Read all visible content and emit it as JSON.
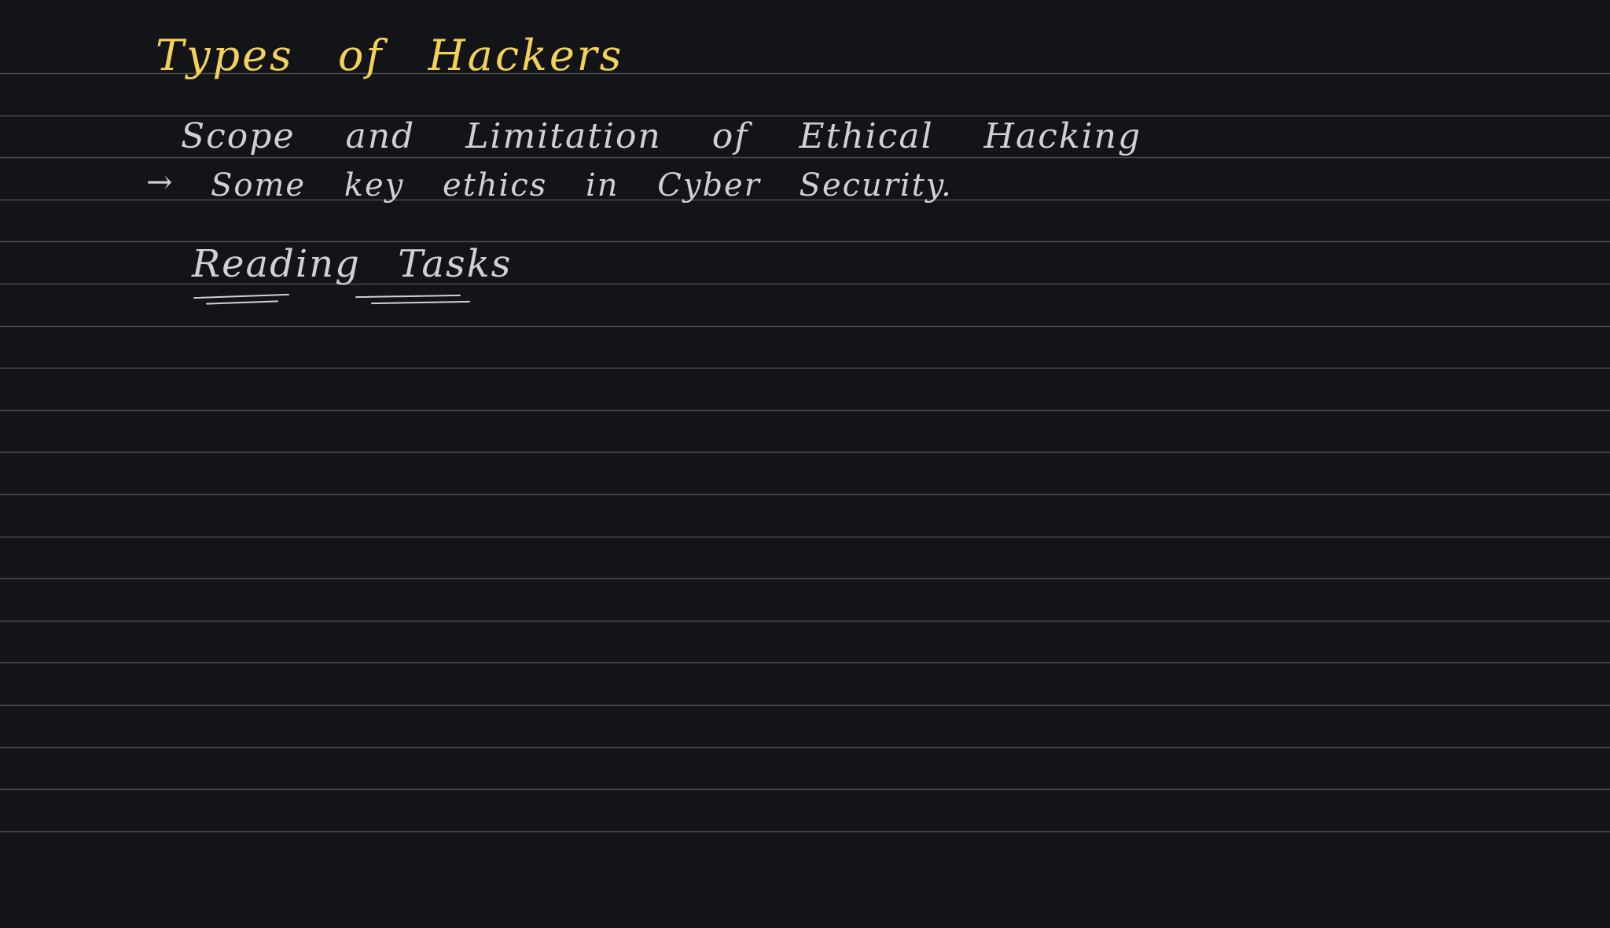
{
  "colors": {
    "background": "#131417",
    "rule_line": "#4a4c50",
    "title_ink": "#f2d15c",
    "body_ink": "#cfd1d4"
  },
  "note": {
    "title": "Types of Hackers",
    "line1": "Scope and Limitation of Ethical Hacking",
    "line2_marker": "→",
    "line2": "Some key ethics in Cyber Security.",
    "line3": "Reading Tasks"
  }
}
